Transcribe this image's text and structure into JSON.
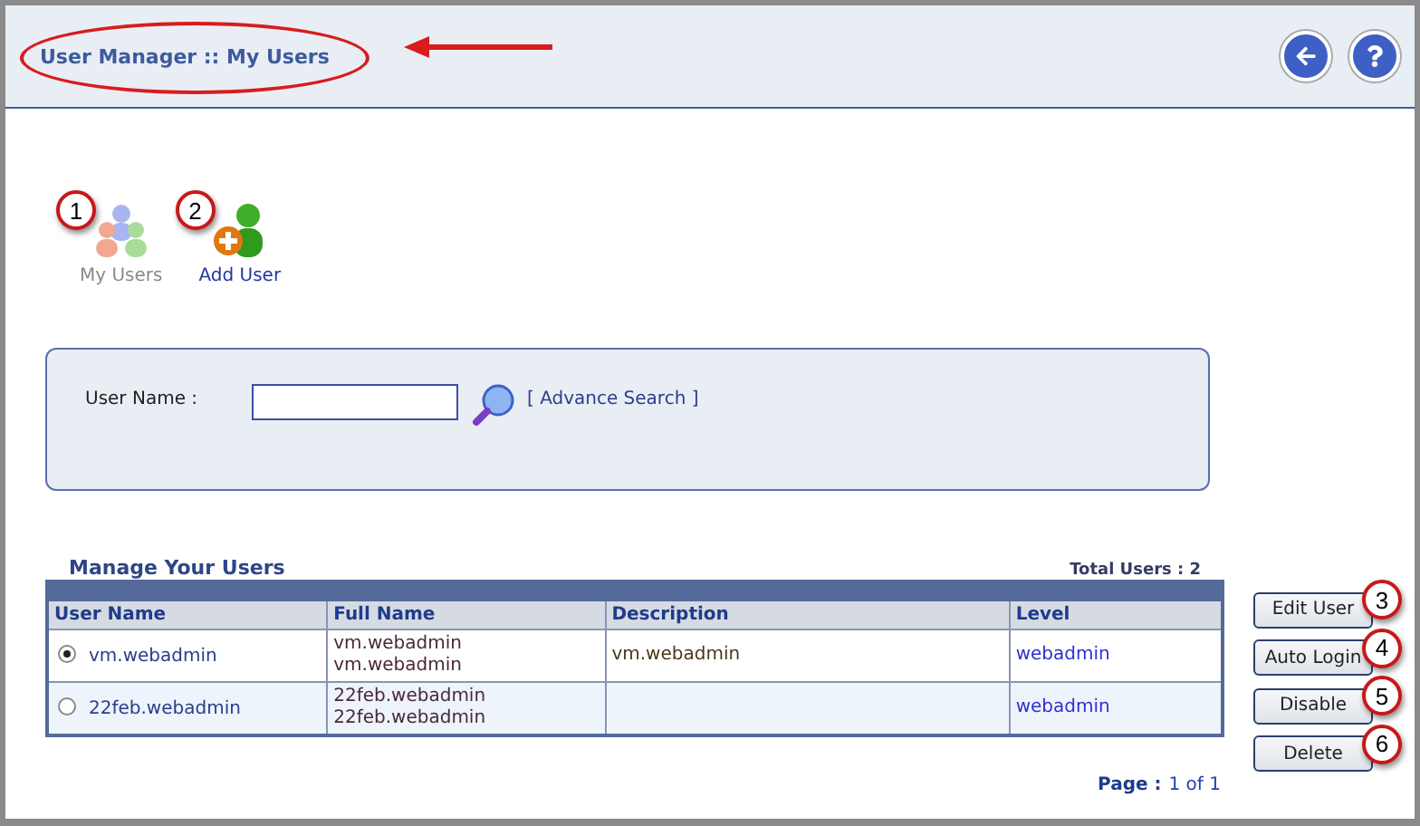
{
  "header": {
    "title": "User Manager :: My Users",
    "highlighted": true,
    "buttons": [
      {
        "kind": "back"
      },
      {
        "kind": "help"
      }
    ]
  },
  "nav": [
    {
      "label": "My Users",
      "callout": "1",
      "kind": "users",
      "selected": true
    },
    {
      "label": "Add User",
      "callout": "2",
      "kind": "add",
      "selected": false
    }
  ],
  "search": {
    "label": "User Name :",
    "link": "[ Advance Search ]"
  },
  "table": {
    "title": "Manage Your Users",
    "total": "Total Users : 2",
    "columns": [
      "User Name",
      "Full Name",
      "Description",
      "Level"
    ],
    "rows": [
      {
        "selected": true,
        "user_name": "vm.webadmin",
        "full_name": [
          "vm.webadmin",
          "vm.webadmin"
        ],
        "description": "vm.webadmin",
        "level": "webadmin"
      },
      {
        "selected": false,
        "user_name": "22feb.webadmin",
        "full_name": [
          "22feb.webadmin",
          "22feb.webadmin"
        ],
        "level": "webadmin"
      }
    ]
  },
  "actions": [
    {
      "label": "Edit User",
      "callout": "3"
    },
    {
      "label": "Auto Login",
      "callout": "4"
    },
    {
      "label": "Disable",
      "callout": "5"
    },
    {
      "label": "Delete",
      "callout": "6"
    }
  ],
  "pager": {
    "label": "Page :",
    "value": "1 of 1"
  }
}
